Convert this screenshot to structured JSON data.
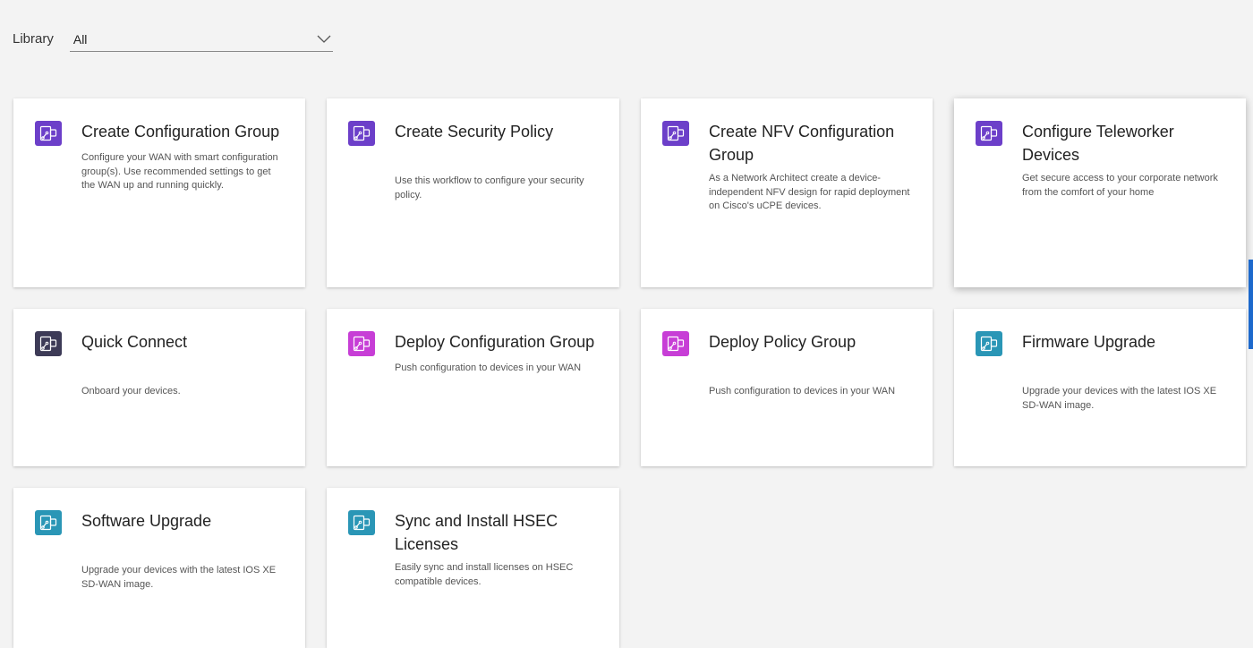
{
  "library": {
    "label": "Library",
    "value": "All"
  },
  "colors": {
    "purple": "#6c3fc9",
    "dark": "#3d3b57",
    "magenta": "#c73ed6",
    "teal": "#2a96b6",
    "scroll": "#1d69cc"
  },
  "cards": [
    {
      "title": "Create Configuration Group",
      "desc": "Configure your WAN with smart configuration group(s). Use recommended settings to get the WAN up and running quickly.",
      "icon": "workflow-icon",
      "color": "#6c3fc9"
    },
    {
      "title": "Create Security Policy",
      "desc": "Use this workflow to configure your security policy.",
      "icon": "workflow-icon",
      "color": "#6c3fc9"
    },
    {
      "title": "Create NFV Configuration Group",
      "desc": "As a Network Architect create a device-independent NFV design for rapid deployment on Cisco's uCPE devices.",
      "icon": "workflow-icon",
      "color": "#6c3fc9"
    },
    {
      "title": "Configure Teleworker Devices",
      "desc": "Get secure access to your corporate network from the comfort of your home",
      "icon": "workflow-icon",
      "color": "#6c3fc9"
    },
    {
      "title": "Quick Connect",
      "desc": "Onboard your devices.",
      "icon": "workflow-icon",
      "color": "#3d3b57"
    },
    {
      "title": "Deploy Configuration Group",
      "desc": "Push configuration to devices in your WAN",
      "icon": "workflow-icon",
      "color": "#c73ed6"
    },
    {
      "title": "Deploy Policy Group",
      "desc": "Push configuration to devices in your WAN",
      "icon": "workflow-icon",
      "color": "#c73ed6"
    },
    {
      "title": "Firmware Upgrade",
      "desc": "Upgrade your devices with the latest IOS XE SD-WAN image.",
      "icon": "workflow-icon",
      "color": "#2a96b6"
    },
    {
      "title": "Software Upgrade",
      "desc": "Upgrade your devices with the latest IOS XE SD-WAN image.",
      "icon": "workflow-icon",
      "color": "#2a96b6"
    },
    {
      "title": "Sync and Install HSEC Licenses",
      "desc": "Easily sync and install licenses on HSEC compatible devices.",
      "icon": "workflow-icon",
      "color": "#2a96b6"
    }
  ]
}
